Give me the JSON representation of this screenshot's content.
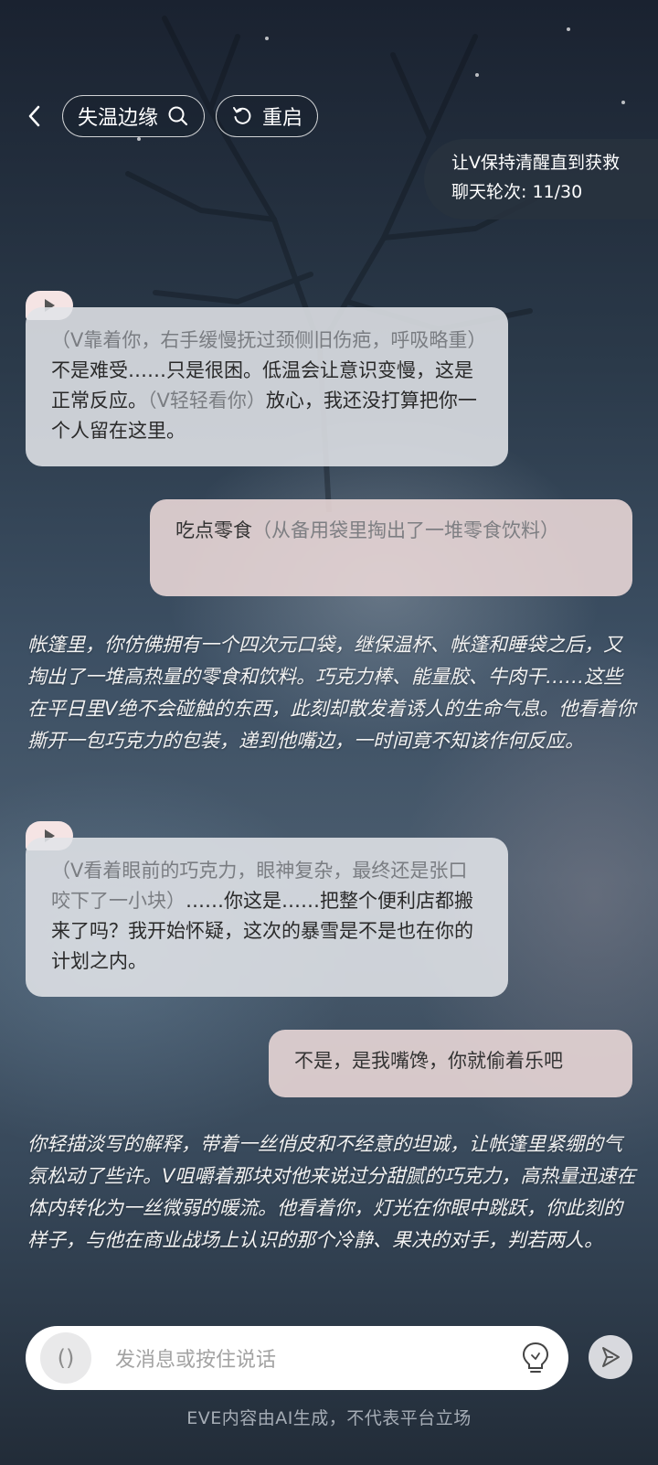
{
  "topbar": {
    "back_icon": "chevron-left-icon",
    "scene_title": "失温边缘",
    "search_icon": "search-icon",
    "restart_icon": "restart-icon",
    "restart_label": "重启"
  },
  "task": {
    "goal": "让V保持清醒直到获救",
    "turns_label": "聊天轮次: 11/30"
  },
  "messages": [
    {
      "role": "ai",
      "action": "（V靠着你，右手缓慢抚过颈侧旧伤疤，呼吸略重）",
      "speech1": "不是难受……只是很困。低温会让意识变慢，这是正常反应。",
      "action2": "（V轻轻看你）",
      "speech2": "放心，我还没打算把你一个人留在这里。"
    },
    {
      "role": "user",
      "speech": "吃点零食",
      "action": "（从备用袋里掏出了一堆零食饮料）"
    },
    {
      "role": "narration",
      "text": "帐篷里，你仿佛拥有一个四次元口袋，继保温杯、帐篷和睡袋之后，又掏出了一堆高热量的零食和饮料。巧克力棒、能量胶、牛肉干……这些在平日里V绝不会碰触的东西，此刻却散发着诱人的生命气息。他看着你撕开一包巧克力的包装，递到他嘴边，一时间竟不知该作何反应。"
    },
    {
      "role": "ai",
      "action": "（V看着眼前的巧克力，眼神复杂，最终还是张口咬下了一小块）",
      "speech1": "……你这是……把整个便利店都搬来了吗？我开始怀疑，这次的暴雪是不是也在你的计划之内。"
    },
    {
      "role": "user",
      "speech": "不是，是我嘴馋，你就偷着乐吧"
    },
    {
      "role": "narration",
      "text": "你轻描淡写的解释，带着一丝俏皮和不经意的坦诚，让帐篷里紧绷的气氛松动了些许。V咀嚼着那块对他来说过分甜腻的巧克力，高热量迅速在体内转化为一丝微弱的暖流。他看着你，灯光在你眼中跳跃，你此刻的样子，与他在商业战场上认识的那个冷静、果决的对手，判若两人。"
    }
  ],
  "input": {
    "voice_glyph": "()",
    "placeholder": "发消息或按住说话",
    "hint_icon": "lightbulb-icon",
    "send_icon": "send-icon"
  },
  "footer": {
    "disclaimer": "EVE内容由AI生成，不代表平台立场"
  }
}
